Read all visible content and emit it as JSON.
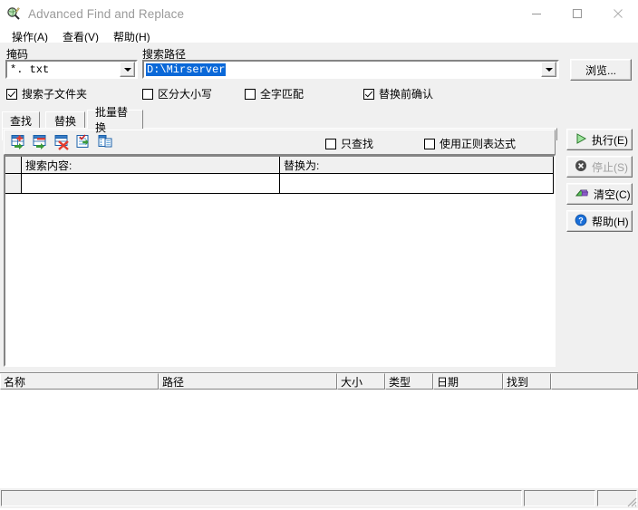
{
  "window": {
    "title": "Advanced Find and Replace",
    "icon": "magnifier-globe-icon",
    "controls": {
      "minimize": "minimize-icon",
      "maximize": "maximize-icon",
      "close": "close-icon"
    }
  },
  "menubar": {
    "items": [
      {
        "label": "操作(A)"
      },
      {
        "label": "查看(V)"
      },
      {
        "label": "帮助(H)"
      }
    ]
  },
  "search_setup": {
    "mask_label": "掩码",
    "mask_value": "*. txt",
    "path_label": "搜索路径",
    "path_value": "D:\\Mirserver",
    "browse_label": "浏览...",
    "options": [
      {
        "label": "搜索子文件夹",
        "checked": true
      },
      {
        "label": "区分大小写",
        "checked": false
      },
      {
        "label": "全字匹配",
        "checked": false
      },
      {
        "label": "替换前确认",
        "checked": true
      }
    ]
  },
  "tabs": [
    {
      "label": "查找",
      "active": false
    },
    {
      "label": "替换",
      "active": false
    },
    {
      "label": "批量替换",
      "active": true
    }
  ],
  "toolbar": {
    "icons": [
      {
        "name": "add-row-icon"
      },
      {
        "name": "insert-row-icon"
      },
      {
        "name": "delete-row-icon"
      },
      {
        "name": "load-list-icon"
      },
      {
        "name": "copy-list-icon"
      }
    ],
    "options": [
      {
        "label": "只查找",
        "checked": false
      },
      {
        "label": "使用正则表达式",
        "checked": false
      }
    ]
  },
  "replace_grid": {
    "columns": [
      "",
      "搜索内容:",
      "替换为:"
    ],
    "rows": [
      {
        "cells": [
          "",
          "",
          ""
        ]
      }
    ]
  },
  "action_buttons": [
    {
      "label": "执行(E)",
      "accel": "E",
      "icon": "play-icon",
      "enabled": true
    },
    {
      "label": "停止(S)",
      "accel": "S",
      "icon": "stop-icon",
      "enabled": false
    },
    {
      "label": "清空(C)",
      "accel": "C",
      "icon": "eraser-icon",
      "enabled": true
    },
    {
      "label": "帮助(H)",
      "accel": "H",
      "icon": "help-icon",
      "enabled": true
    }
  ],
  "results": {
    "columns": [
      "名称",
      "路径",
      "大小",
      "类型",
      "日期",
      "找到",
      ""
    ],
    "rows": []
  },
  "statusbar": {
    "panes": [
      "",
      "",
      ""
    ],
    "grip": "resize-grip-icon"
  },
  "colors": {
    "face": "#f0f0f0",
    "selection": "#0a68d8",
    "title_text": "#9a9a9a",
    "disabled_text": "#a0a0a0"
  }
}
